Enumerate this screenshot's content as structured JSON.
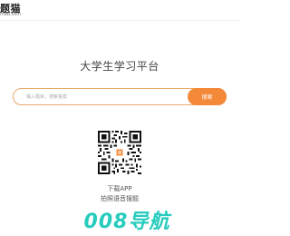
{
  "header": {
    "logo_name": "题猫",
    "logo_domain": "mao.com"
  },
  "main": {
    "title": "大学生学习平台",
    "search": {
      "placeholder": "输入题目，搜索答案",
      "button_label": "搜索"
    },
    "app": {
      "download_label": "下载APP",
      "app_name": "拍照语音搜题"
    }
  },
  "watermark": "008导航",
  "colors": {
    "accent": "#f4893a",
    "watermark": "#14c8b8",
    "search_border": "#e8a96a"
  },
  "icons": {
    "qr": "qr-code-icon"
  }
}
